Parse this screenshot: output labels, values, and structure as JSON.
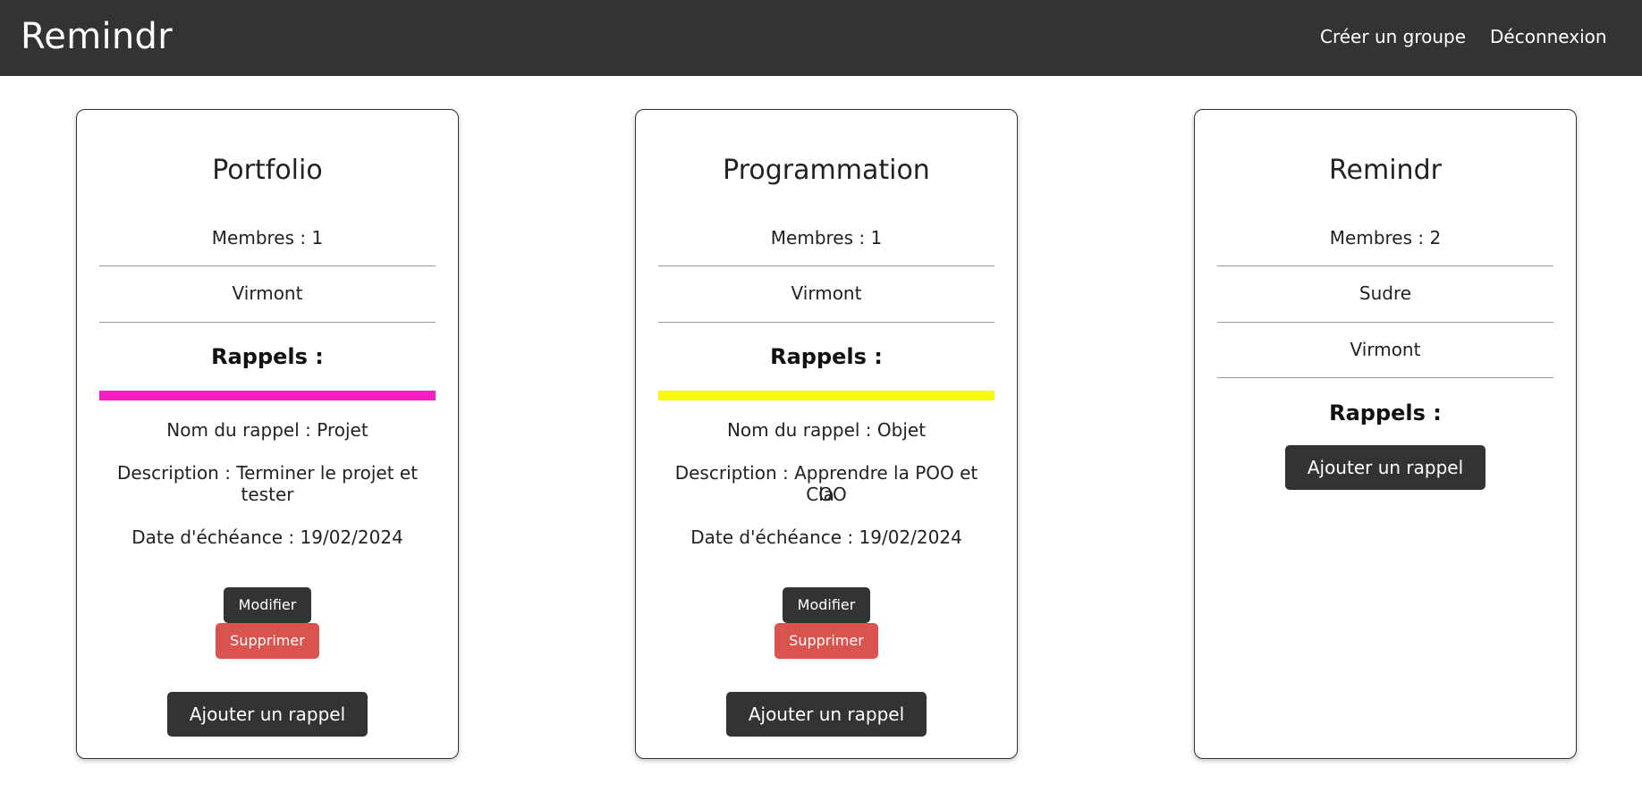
{
  "navbar": {
    "brand": "Remindr",
    "create_group": "Créer un groupe",
    "logout": "Déconnexion"
  },
  "groups": [
    {
      "title": "Portfolio",
      "members_label": "Membres : 1",
      "members": [
        "Virmont"
      ],
      "reminders_title": "Rappels :",
      "reminders": [
        {
          "color": "#f51fc4",
          "name": "Nom du rappel : Projet",
          "description_line1": "Description : Terminer le projet et",
          "description_line2": "tester",
          "due_date": "Date d'échéance : 19/02/2024",
          "modify_label": "Modifier",
          "delete_label": "Supprimer"
        }
      ],
      "add_label": "Ajouter un rappel"
    },
    {
      "title": "Programmation",
      "members_label": "Membres : 1",
      "members": [
        "Virmont"
      ],
      "reminders_title": "Rappels :",
      "reminders": [
        {
          "color": "#f5f80f",
          "name": "Nom du rappel : Objet",
          "description_line1": "Description : Apprendre la POO et la",
          "description_line2": "COO",
          "due_date": "Date d'échéance : 19/02/2024",
          "modify_label": "Modifier",
          "delete_label": "Supprimer"
        }
      ],
      "add_label": "Ajouter un rappel"
    },
    {
      "title": "Remindr",
      "members_label": "Membres : 2",
      "members": [
        "Sudre",
        "Virmont"
      ],
      "reminders_title": "Rappels :",
      "reminders": [],
      "add_label": "Ajouter un rappel"
    }
  ],
  "colors": {
    "navbar_bg": "#333333",
    "primary_button": "#333333",
    "danger_button": "#d9534f"
  }
}
